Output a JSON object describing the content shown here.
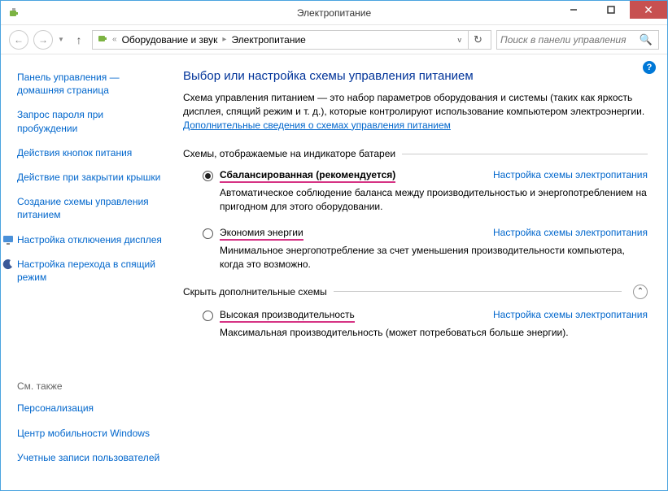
{
  "window": {
    "title": "Электропитание"
  },
  "breadcrumb": {
    "hw_sound": "Оборудование и звук",
    "power": "Электропитание",
    "back_chevron": "«"
  },
  "search": {
    "placeholder": "Поиск в панели управления"
  },
  "sidebar": {
    "home": "Панель управления — домашняя страница",
    "wake_password": "Запрос пароля при пробуждении",
    "button_actions": "Действия кнопок питания",
    "lid_action": "Действие при закрытии крышки",
    "create_plan": "Создание схемы управления питанием",
    "display_off": "Настройка отключения дисплея",
    "sleep": "Настройка перехода в спящий режим",
    "see_also": "См. также",
    "personalization": "Персонализация",
    "mobility": "Центр мобильности Windows",
    "user_accounts": "Учетные записи пользователей"
  },
  "main": {
    "heading": "Выбор или настройка схемы управления питанием",
    "desc_before": "Схема управления питанием — это набор параметров оборудования и системы (таких как яркость дисплея, спящий режим и т. д.), которые контролируют использование компьютером электроэнергии. ",
    "desc_link": "Дополнительные сведения о схемах управления питанием",
    "group_battery": "Схемы, отображаемые на индикаторе батареи",
    "group_hide": "Скрыть дополнительные схемы",
    "settings_link": "Настройка схемы электропитания",
    "plans": {
      "balanced": {
        "name": "Сбалансированная (рекомендуется)",
        "desc": "Автоматическое соблюдение баланса между производительностью и энергопотреблением на пригодном для этого оборудовании."
      },
      "saver": {
        "name": "Экономия энергии",
        "desc": "Минимальное энергопотребление за счет уменьшения производительности компьютера, когда это возможно."
      },
      "high": {
        "name": "Высокая производительность",
        "desc": "Максимальная производительность (может потребоваться больше энергии)."
      }
    }
  }
}
